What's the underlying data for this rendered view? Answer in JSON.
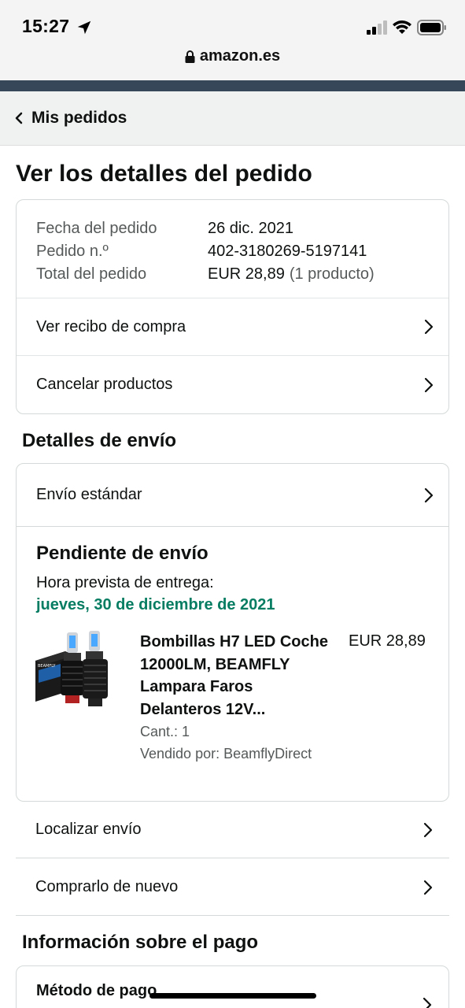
{
  "status_bar": {
    "time": "15:27",
    "icons": [
      "location-arrow-icon",
      "signal-icon",
      "wifi-icon",
      "battery-icon"
    ]
  },
  "browser": {
    "url": "amazon.es",
    "secure_icon": "lock-icon"
  },
  "breadcrumb": {
    "back_label": "Mis pedidos",
    "icon": "chevron-left-icon"
  },
  "page": {
    "title": "Ver los detalles del pedido"
  },
  "order_summary": {
    "rows": [
      {
        "label": "Fecha del pedido",
        "value": "26 dic. 2021",
        "extra": ""
      },
      {
        "label": "Pedido n.º",
        "value": "402-3180269-5197141",
        "extra": ""
      },
      {
        "label": "Total del pedido",
        "value": "EUR 28,89",
        "extra": "(1 producto)"
      }
    ],
    "actions": [
      {
        "label": "Ver recibo de compra",
        "icon": "chevron-right-icon"
      },
      {
        "label": "Cancelar productos",
        "icon": "chevron-right-icon"
      }
    ]
  },
  "shipping": {
    "section_title": "Detalles de envío",
    "method": "Envío estándar",
    "status": "Pendiente de envío",
    "eta_label": "Hora prevista de entrega:",
    "eta_date": "jueves, 30 de diciembre de 2021",
    "product": {
      "title": "Bombillas H7 LED Coche 12000LM, BEAMFLY Lampara Faros Delanteros 12V...",
      "price": "EUR 28,89",
      "quantity": "Cant.: 1",
      "seller": "Vendido por: BeamflyDirect",
      "image_icon": "led-bulbs-product-image",
      "image_brand_text": "BEAMFLY"
    },
    "actions": [
      {
        "label": "Localizar envío",
        "icon": "chevron-right-icon"
      },
      {
        "label": "Comprarlo de nuevo",
        "icon": "chevron-right-icon"
      }
    ]
  },
  "payment": {
    "section_title": "Información sobre el pago",
    "method_label": "Método de pago"
  },
  "colors": {
    "eta_green": "#067d62",
    "nav_strip": "#37475a",
    "breadcrumb_bg": "#f0f2f2",
    "border": "#d5d9d9"
  }
}
